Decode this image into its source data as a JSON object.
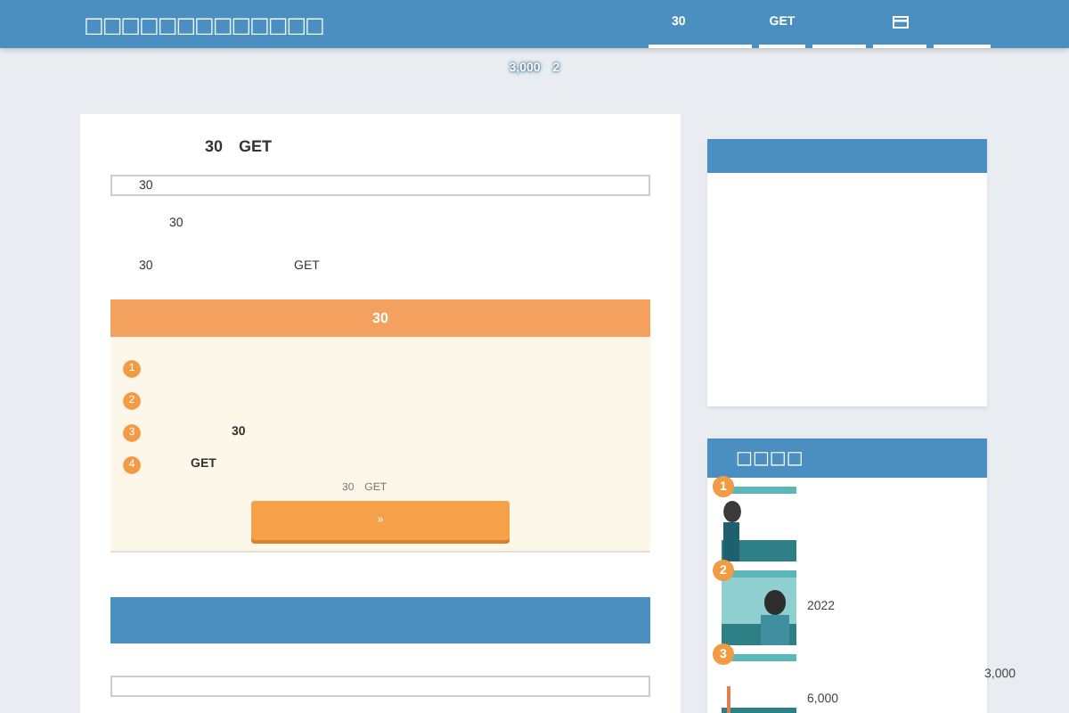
{
  "header": {
    "site_title": "□□□□□□□□□□□□□",
    "nav": [
      {
        "kind": "text",
        "label": "30",
        "selected": false
      },
      {
        "kind": "text",
        "label": "GET",
        "selected": false
      },
      {
        "kind": "spacer",
        "selected": false
      },
      {
        "kind": "icon",
        "selected": false
      },
      {
        "kind": "spacer",
        "selected": false
      }
    ],
    "tagline": "3,000　2"
  },
  "article": {
    "title": "30　GET",
    "box_text": "30",
    "para_1": "30",
    "para_2": [
      {
        "text": "30"
      },
      {
        "text": "GET"
      }
    ],
    "callout": {
      "heading": "30",
      "items": [
        {
          "number": "1"
        },
        {
          "number": "2"
        },
        {
          "number": "3",
          "text": "30"
        },
        {
          "number": "4",
          "text": "GET"
        }
      ],
      "note": "30　GET",
      "button": "»"
    }
  },
  "sidebar": {
    "widgets": [
      {
        "kind": "blank"
      },
      {
        "kind": "ranking",
        "title": "□□□□",
        "items": [
          {
            "rank": "1"
          },
          {
            "rank": "2",
            "texts": [
              "2022"
            ]
          },
          {
            "rank": "3",
            "texts": [
              "6,000",
              "3,000"
            ]
          }
        ]
      }
    ]
  }
}
